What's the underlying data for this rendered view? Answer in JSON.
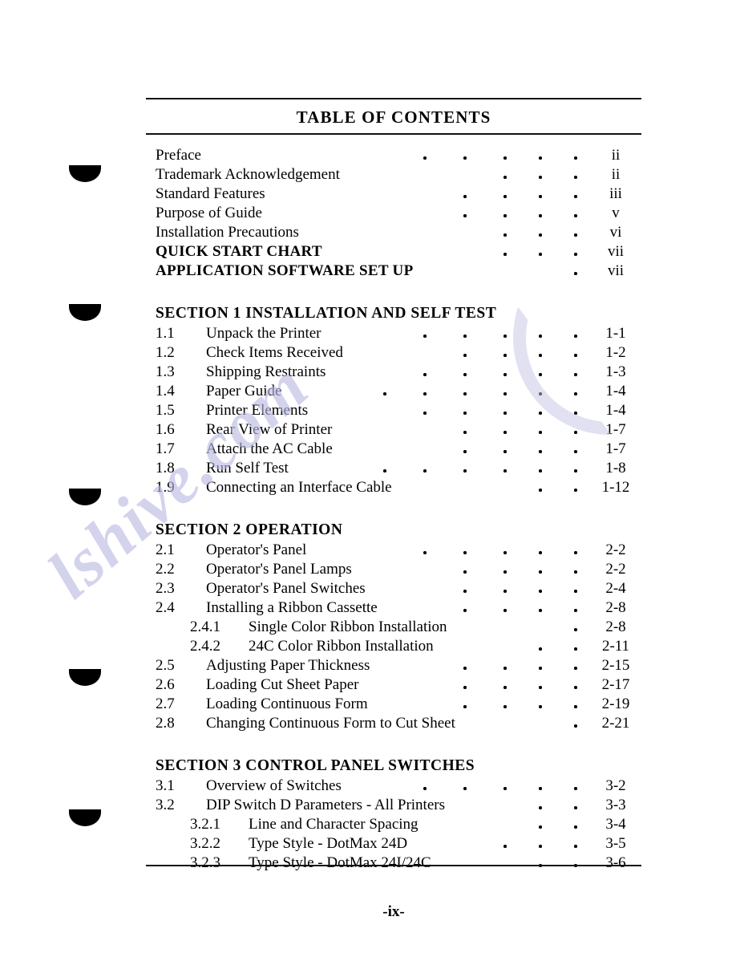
{
  "page": {
    "title": "TABLE OF CONTENTS",
    "folio": "-ix-"
  },
  "front_matter": [
    {
      "label": "Preface",
      "page": "ii",
      "bold": false,
      "leader_start": 3
    },
    {
      "label": "Trademark Acknowledgement",
      "page": "ii",
      "bold": false,
      "leader_start": 5
    },
    {
      "label": "Standard Features",
      "page": "iii",
      "bold": false,
      "leader_start": 4
    },
    {
      "label": "Purpose of Guide",
      "page": "v",
      "bold": false,
      "leader_start": 4
    },
    {
      "label": "Installation Precautions",
      "page": "vi",
      "bold": false,
      "leader_start": 5
    },
    {
      "label": "QUICK START CHART",
      "page": "vii",
      "bold": true,
      "leader_start": 5
    },
    {
      "label": "APPLICATION SOFTWARE SET UP",
      "page": "vii",
      "bold": true,
      "leader_start": 7
    }
  ],
  "sections": [
    {
      "heading": "SECTION 1  INSTALLATION AND SELF TEST",
      "entries": [
        {
          "num": "1.1",
          "label": "Unpack the Printer",
          "page": "1-1",
          "sub": false,
          "leader_start": 3
        },
        {
          "num": "1.2",
          "label": "Check Items Received",
          "page": "1-2",
          "sub": false,
          "leader_start": 4
        },
        {
          "num": "1.3",
          "label": "Shipping Restraints",
          "page": "1-3",
          "sub": false,
          "leader_start": 3
        },
        {
          "num": "1.4",
          "label": "Paper Guide",
          "page": "1-4",
          "sub": false,
          "leader_start": 2
        },
        {
          "num": "1.5",
          "label": "Printer Elements",
          "page": "1-4",
          "sub": false,
          "leader_start": 3
        },
        {
          "num": "1.6",
          "label": "Rear View of Printer",
          "page": "1-7",
          "sub": false,
          "leader_start": 4
        },
        {
          "num": "1.7",
          "label": "Attach the AC Cable",
          "page": "1-7",
          "sub": false,
          "leader_start": 4
        },
        {
          "num": "1.8",
          "label": "Run Self Test",
          "page": "1-8",
          "sub": false,
          "leader_start": 2
        },
        {
          "num": "1.9",
          "label": "Connecting an Interface Cable",
          "page": "1-12",
          "sub": false,
          "leader_start": 6
        }
      ]
    },
    {
      "heading": "SECTION 2  OPERATION",
      "entries": [
        {
          "num": "2.1",
          "label": "Operator's Panel",
          "page": "2-2",
          "sub": false,
          "leader_start": 3
        },
        {
          "num": "2.2",
          "label": "Operator's Panel Lamps",
          "page": "2-2",
          "sub": false,
          "leader_start": 4
        },
        {
          "num": "2.3",
          "label": "Operator's Panel Switches",
          "page": "2-4",
          "sub": false,
          "leader_start": 4
        },
        {
          "num": "2.4",
          "label": "Installing a Ribbon Cassette",
          "page": "2-8",
          "sub": false,
          "leader_start": 4
        },
        {
          "num": "2.4.1",
          "label": "Single Color Ribbon Installation",
          "page": "2-8",
          "sub": true,
          "leader_start": 7
        },
        {
          "num": "2.4.2",
          "label": "24C Color Ribbon Installation",
          "page": "2-11",
          "sub": true,
          "leader_start": 6
        },
        {
          "num": "2.5",
          "label": "Adjusting Paper Thickness",
          "page": "2-15",
          "sub": false,
          "leader_start": 4
        },
        {
          "num": "2.6",
          "label": "Loading Cut Sheet Paper",
          "page": "2-17",
          "sub": false,
          "leader_start": 4
        },
        {
          "num": "2.7",
          "label": "Loading Continuous Form",
          "page": "2-19",
          "sub": false,
          "leader_start": 4
        },
        {
          "num": "2.8",
          "label": "Changing Continuous Form to Cut Sheet",
          "page": "2-21",
          "sub": false,
          "leader_start": 7
        }
      ]
    },
    {
      "heading": "SECTION 3  CONTROL PANEL SWITCHES",
      "entries": [
        {
          "num": "3.1",
          "label": "Overview of Switches",
          "page": "3-2",
          "sub": false,
          "leader_start": 3
        },
        {
          "num": "3.2",
          "label": "DIP Switch D Parameters - All Printers",
          "page": "3-3",
          "sub": false,
          "leader_start": 6
        },
        {
          "num": "3.2.1",
          "label": "Line and Character Spacing",
          "page": "3-4",
          "sub": true,
          "leader_start": 6
        },
        {
          "num": "3.2.2",
          "label": "Type Style - DotMax 24D",
          "page": "3-5",
          "sub": true,
          "leader_start": 5
        },
        {
          "num": "3.2.3",
          "label": "Type Style - DotMax 24I/24C",
          "page": "3-6",
          "sub": true,
          "leader_start": 6
        }
      ]
    }
  ],
  "artifacts": {
    "watermark_text": "lshive.com",
    "watermark_color": "#b9b9e2",
    "punch_hole_count": 5
  }
}
